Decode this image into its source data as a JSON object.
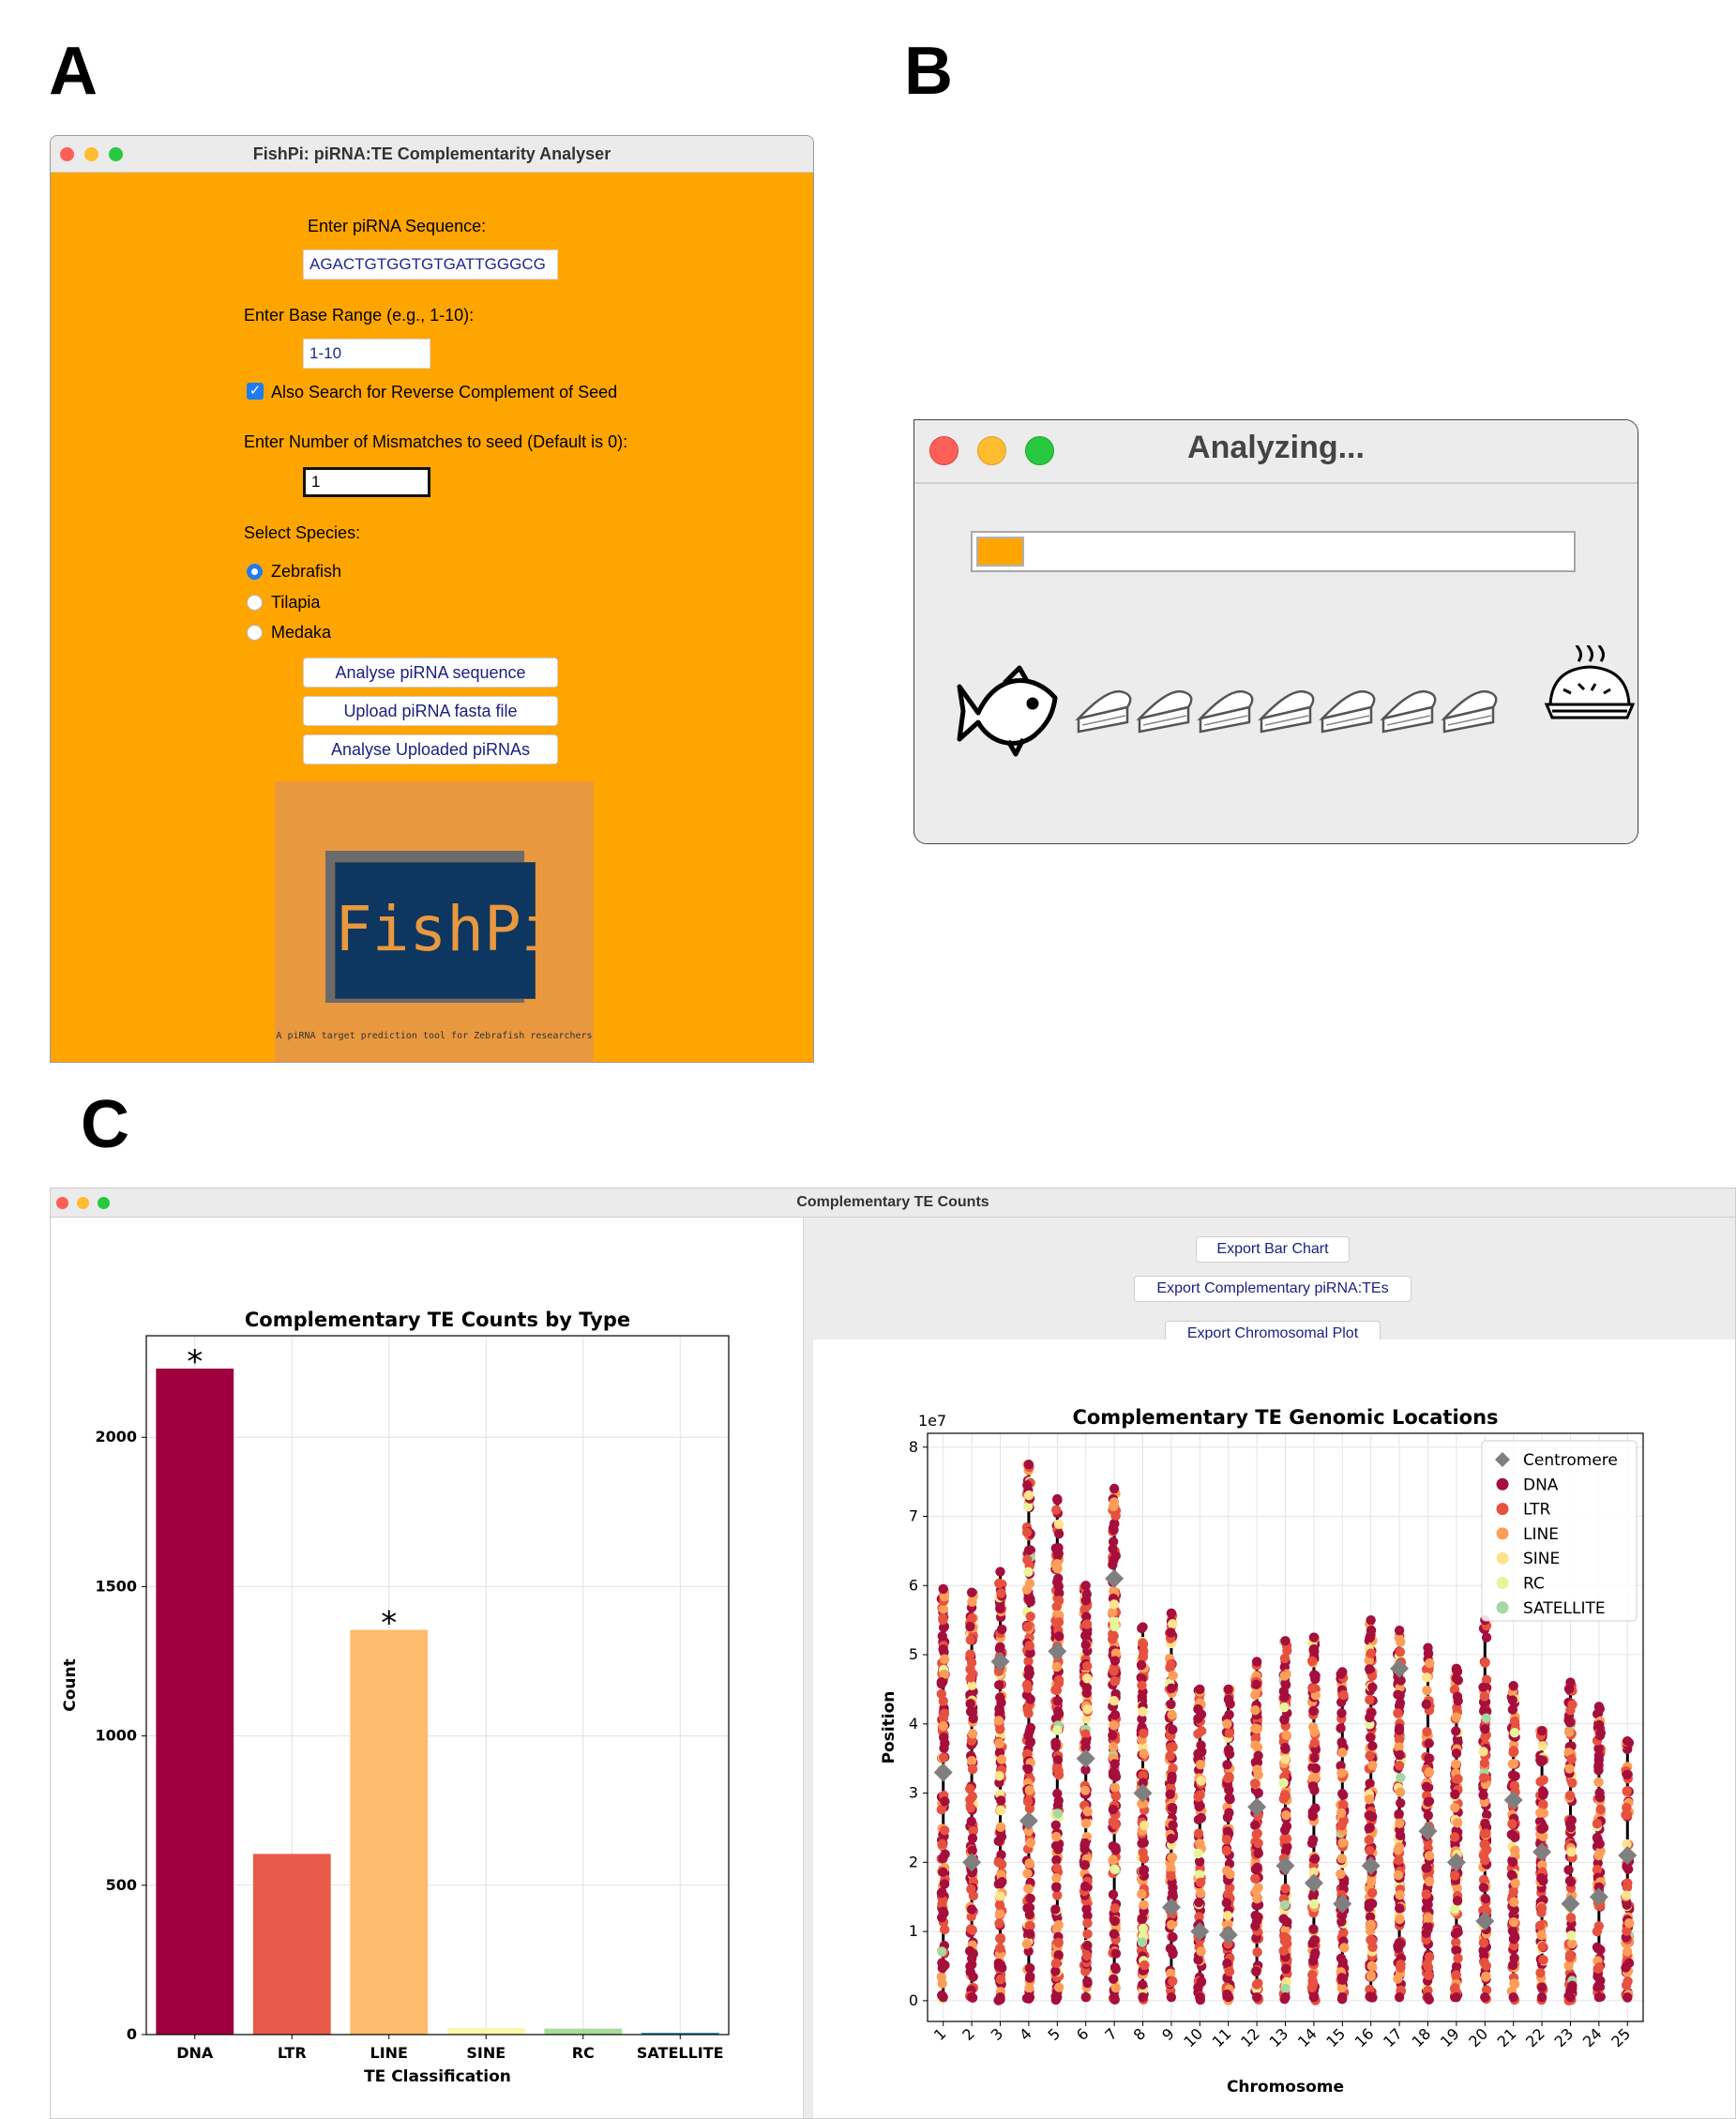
{
  "panels": {
    "a": "A",
    "b": "B",
    "c": "C"
  },
  "window_a": {
    "title": "FishPi: piRNA:TE Complementarity Analyser",
    "sequence_label": "Enter piRNA Sequence:",
    "sequence_value": "AGACTGTGGTGTGATTGGGCG",
    "range_label": "Enter Base Range (e.g., 1-10):",
    "range_value": "1-10",
    "revcomp_label": "Also Search for Reverse Complement of Seed",
    "revcomp_checked": true,
    "mismatch_label": "Enter Number of Mismatches to seed (Default is 0):",
    "mismatch_value": "1",
    "species_label": "Select Species:",
    "species": [
      "Zebrafish",
      "Tilapia",
      "Medaka"
    ],
    "species_selected": "Zebrafish",
    "buttons": [
      "Analyse piRNA sequence",
      "Upload piRNA fasta file",
      "Analyse Uploaded piRNAs"
    ],
    "logo_text": "FishPi",
    "logo_tagline": "A piRNA target prediction tool for Zebrafish researchers",
    "colors": {
      "background": "#FFA500",
      "logo_bg": "#E8983F",
      "logo_box": "#0D3660"
    }
  },
  "window_b": {
    "title": "Analyzing...",
    "progress": 0.08,
    "pie_slices": 7,
    "icons": [
      "fish-icon",
      "pie-slice-icon",
      "whole-pie-icon"
    ]
  },
  "window_c": {
    "title": "Complementary TE Counts",
    "export_buttons": [
      "Export Bar Chart",
      "Export Complementary piRNA:TEs",
      "Export Chromosomal Plot"
    ]
  },
  "chart_data": [
    {
      "type": "bar",
      "title": "Complementary TE Counts by Type",
      "xlabel": "TE Classification",
      "ylabel": "Count",
      "categories": [
        "DNA",
        "LTR",
        "LINE",
        "SINE",
        "RC",
        "SATELLITE"
      ],
      "values": [
        2230,
        605,
        1355,
        22,
        20,
        6
      ],
      "colors": [
        "#A0003F",
        "#E95B49",
        "#FDBB6C",
        "#FCF8AA",
        "#A9DB9D",
        "#2F8BAE"
      ],
      "significant": [
        "DNA",
        "LINE"
      ],
      "annotation": "*",
      "ylim": [
        0,
        2340
      ],
      "yticks": [
        0,
        500,
        1000,
        1500,
        2000
      ],
      "grid": true
    },
    {
      "type": "scatter",
      "title": "Complementary TE Genomic Locations",
      "xlabel": "Chromosome",
      "ylabel": "Position",
      "y_scale_label": "1e7",
      "categories": [
        "1",
        "2",
        "3",
        "4",
        "5",
        "6",
        "7",
        "8",
        "9",
        "10",
        "11",
        "12",
        "13",
        "14",
        "15",
        "16",
        "17",
        "18",
        "19",
        "20",
        "21",
        "22",
        "23",
        "24",
        "25"
      ],
      "yticks": [
        0,
        1,
        2,
        3,
        4,
        5,
        6,
        7,
        8
      ],
      "ylim": [
        -0.3,
        8.2
      ],
      "legend": {
        "placement": "top-right",
        "entries": [
          {
            "name": "Centromere",
            "color": "#7F7F7F",
            "marker": "diamond"
          },
          {
            "name": "DNA",
            "color": "#A50F3C",
            "marker": "circle"
          },
          {
            "name": "LTR",
            "color": "#E6523F",
            "marker": "circle"
          },
          {
            "name": "LINE",
            "color": "#FC9E58",
            "marker": "circle"
          },
          {
            "name": "SINE",
            "color": "#FEE38D",
            "marker": "circle"
          },
          {
            "name": "RC",
            "color": "#E6F49C",
            "marker": "circle"
          },
          {
            "name": "SATELLITE",
            "color": "#A5D8A4",
            "marker": "circle"
          }
        ]
      },
      "chromosome_max": [
        5.95,
        5.9,
        6.2,
        7.75,
        7.25,
        6.0,
        7.4,
        5.4,
        5.6,
        4.5,
        4.5,
        4.9,
        5.2,
        5.25,
        4.75,
        5.5,
        5.35,
        5.1,
        4.8,
        5.5,
        4.55,
        3.9,
        4.6,
        4.25,
        3.75
      ],
      "centromeres": [
        3.3,
        2.0,
        4.9,
        2.6,
        5.05,
        3.5,
        6.1,
        3.0,
        1.35,
        1.0,
        0.95,
        2.8,
        1.95,
        1.7,
        1.4,
        1.95,
        4.8,
        2.45,
        2.0,
        1.15,
        2.9,
        2.15,
        1.4,
        1.5,
        2.1
      ],
      "grid": true
    }
  ]
}
